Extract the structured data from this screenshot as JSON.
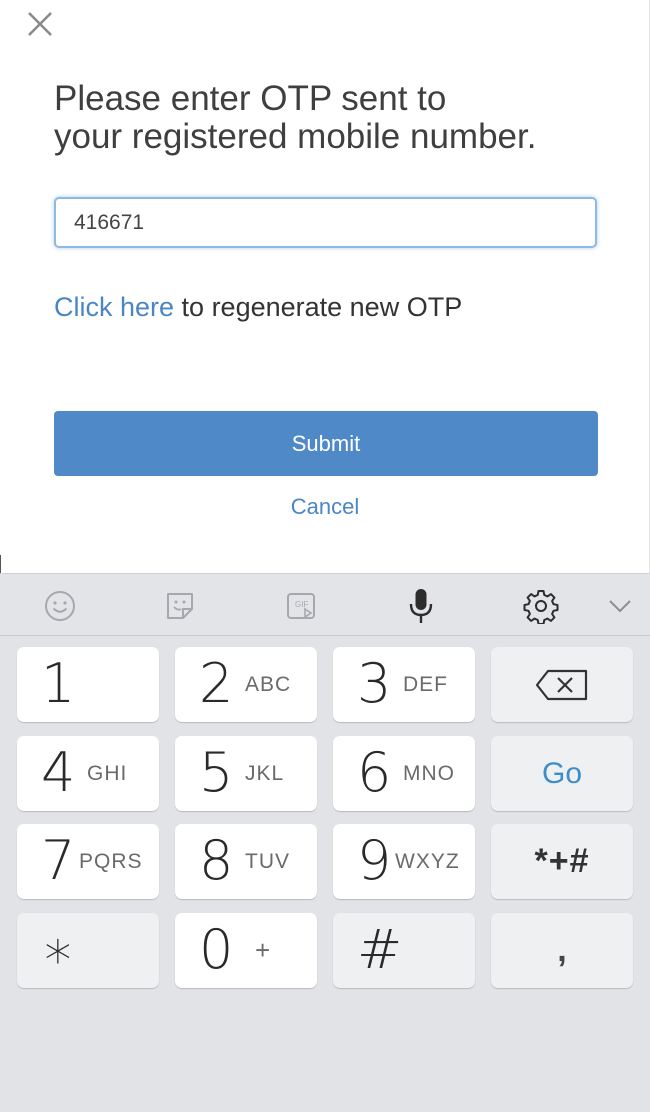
{
  "dialog": {
    "title_line1": "Please enter OTP sent to",
    "title_line2": "your registered mobile number.",
    "otp_value": "416671",
    "regen_link": "Click here",
    "regen_text": " to regenerate new OTP",
    "submit_label": "Submit",
    "cancel_label": "Cancel",
    "accent_color": "#4f89c8"
  },
  "keyboard_toolbar": {
    "icons": [
      "emoji-icon",
      "sticker-icon",
      "gif-icon",
      "microphone-icon",
      "settings-icon",
      "chevron-down-icon"
    ],
    "gif_label": "GIF"
  },
  "keyboard": {
    "keys": {
      "k1": {
        "num": "1",
        "sub": ""
      },
      "k2": {
        "num": "2",
        "sub": "ABC"
      },
      "k3": {
        "num": "3",
        "sub": "DEF"
      },
      "k4": {
        "num": "4",
        "sub": "GHI"
      },
      "k5": {
        "num": "5",
        "sub": "JKL"
      },
      "k6": {
        "num": "6",
        "sub": "MNO"
      },
      "k7": {
        "num": "7",
        "sub": "PQRS"
      },
      "k8": {
        "num": "8",
        "sub": "TUV"
      },
      "k9": {
        "num": "9",
        "sub": "WXYZ"
      },
      "kstar": {
        "num": "∗",
        "sub": ""
      },
      "k0": {
        "num": "0",
        "sub": "+"
      },
      "khash": {
        "num": "#",
        "sub": ""
      }
    },
    "go_label": "Go",
    "symbols_label": "*+#",
    "comma_label": ","
  }
}
